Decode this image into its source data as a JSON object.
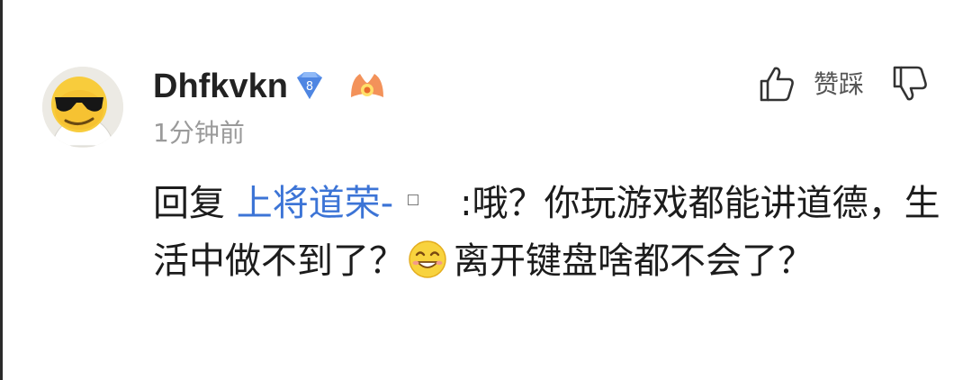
{
  "user": {
    "name": "Dhfkvkn",
    "level": "8",
    "timestamp": "1分钟前"
  },
  "actions": {
    "vote_label": "赞踩"
  },
  "comment": {
    "reply_prefix": "回复",
    "reply_target": "上将道荣-",
    "part1": ":哦？你玩游戏都能讲道德，生活中做不到了？",
    "part2": "离开键盘啥都不会了？"
  },
  "colors": {
    "link": "#3c74d6",
    "level_badge": "#5b8fe6",
    "fan_badge": "#f0894c",
    "timestamp": "#9a9a9a"
  },
  "icons": {
    "avatar": "sunglasses-face-avatar",
    "level": "diamond-level-badge",
    "fan": "fan-badge-icon",
    "like": "thumbs-up-icon",
    "dislike": "thumbs-down-icon",
    "emoji": "laughing-face-emoji"
  }
}
